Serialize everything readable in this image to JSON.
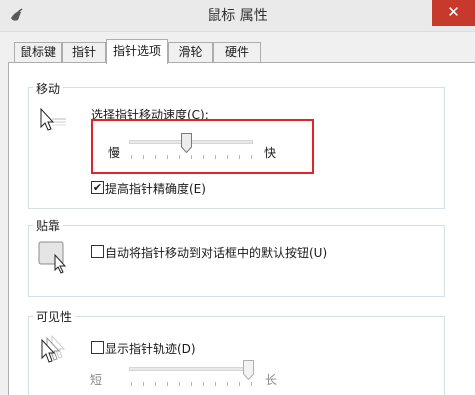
{
  "window": {
    "title": "鼠标 属性",
    "close_glyph": "✕"
  },
  "tabs": [
    {
      "label": "鼠标键",
      "active": false
    },
    {
      "label": "指针",
      "active": false
    },
    {
      "label": "指针选项",
      "active": true
    },
    {
      "label": "滑轮",
      "active": false
    },
    {
      "label": "硬件",
      "active": false
    }
  ],
  "motion": {
    "group_label": "移动",
    "speed_label": "选择指针移动速度(C):",
    "slow_label": "慢",
    "fast_label": "快",
    "speed_value": 6,
    "speed_max": 11,
    "precision_label": "提高指针精确度(E)",
    "precision_checked": true,
    "precision_check_glyph": "✔"
  },
  "snap": {
    "group_label": "贴靠",
    "snap_label": "自动将指针移动到对话框中的默认按钮(U)",
    "snap_checked": false
  },
  "visibility": {
    "group_label": "可见性",
    "trails_label": "显示指针轨迹(D)",
    "trails_checked": false,
    "short_label": "短",
    "long_label": "长",
    "trails_value": 1.0,
    "enabled": false
  },
  "colors": {
    "highlight": "#e0242a",
    "close_bg": "#c7382d"
  }
}
